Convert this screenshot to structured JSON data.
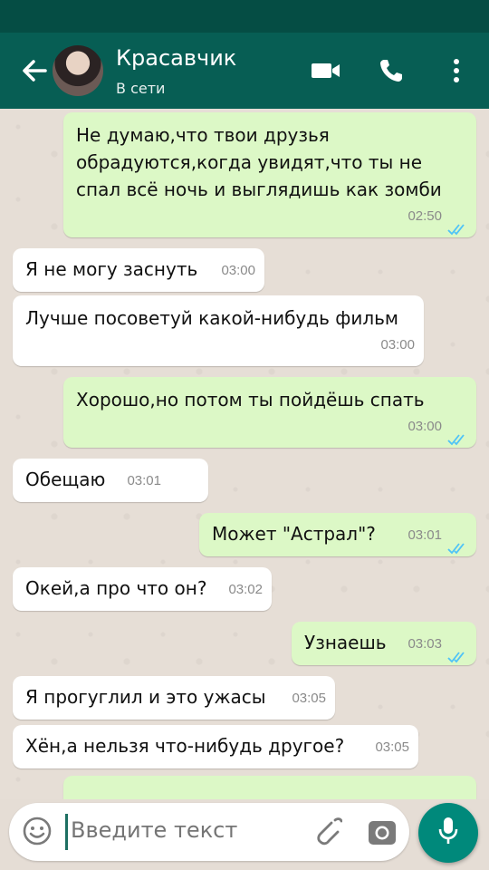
{
  "header": {
    "name": "Красавчик",
    "status": "В сети"
  },
  "messages": [
    {
      "dir": "out",
      "text": "Не думаю,что твои друзья обрадуются,когда увидят,что ты не спал всё ночь и выглядишь как зомби",
      "time": "02:50",
      "read": true
    },
    {
      "dir": "in",
      "text": "Я не могу заснуть",
      "time": "03:00"
    },
    {
      "dir": "in",
      "text": "Лучше посоветуй какой-нибудь фильм",
      "time": "03:00"
    },
    {
      "dir": "out",
      "text": "Хорошо,но потом ты пойдёшь спать",
      "time": "03:00",
      "read": true
    },
    {
      "dir": "in",
      "text": "Обещаю",
      "time": "03:01"
    },
    {
      "dir": "out",
      "text": "Может \"Астрал\"?",
      "time": "03:01",
      "read": true
    },
    {
      "dir": "in",
      "text": "Окей,а про что он?",
      "time": "03:02"
    },
    {
      "dir": "out",
      "text": "Узнаешь",
      "time": "03:03",
      "read": true
    },
    {
      "dir": "in",
      "text": "Я прогуглил и это ужасы",
      "time": "03:05"
    },
    {
      "dir": "in",
      "text": "Хён,а нельзя что-нибудь другое?",
      "time": "03:05"
    }
  ],
  "input": {
    "placeholder": "Введите текст"
  },
  "colors": {
    "header": "#075e54",
    "outgoing": "#dcf8c6",
    "incoming": "#ffffff",
    "read_ticks": "#4fc3f7",
    "fab": "#00897b"
  },
  "icons": [
    "back-arrow-icon",
    "video-call-icon",
    "phone-icon",
    "more-icon",
    "emoji-icon",
    "attach-icon",
    "camera-icon",
    "mic-icon"
  ]
}
